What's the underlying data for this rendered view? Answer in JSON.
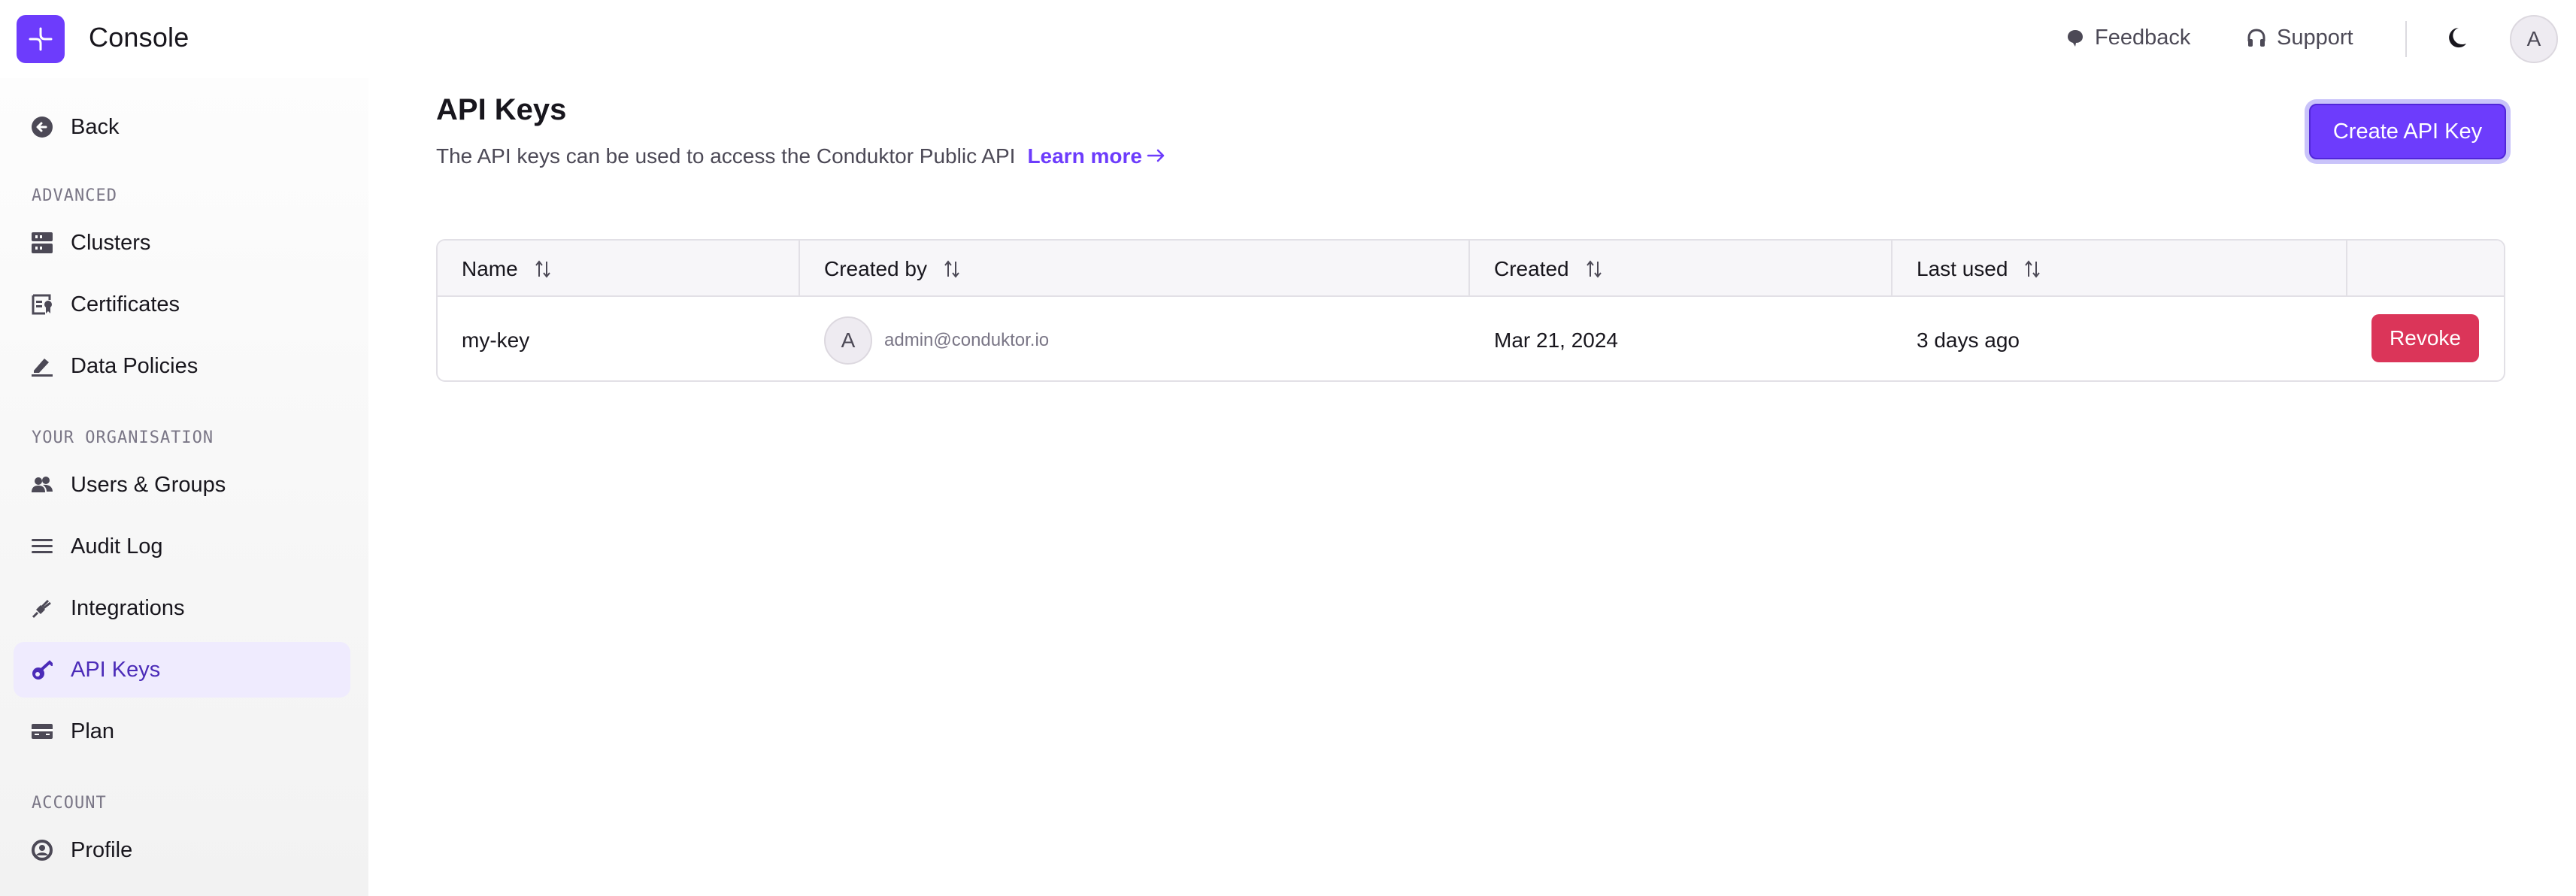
{
  "header": {
    "app_title": "Console",
    "logo_icon": "conduktor-logo-icon",
    "feedback_label": "Feedback",
    "feedback_icon": "speech-bubble-icon",
    "support_label": "Support",
    "support_icon": "headphones-icon",
    "theme_icon": "moon-icon",
    "user_initial": "A"
  },
  "sidebar": {
    "back": {
      "label": "Back",
      "icon": "arrow-left-circle-icon"
    },
    "sections": [
      {
        "title": "ADVANCED",
        "items": [
          {
            "label": "Clusters",
            "icon": "server-icon",
            "active": false
          },
          {
            "label": "Certificates",
            "icon": "certificate-icon",
            "active": false
          },
          {
            "label": "Data Policies",
            "icon": "pen-icon",
            "active": false
          }
        ]
      },
      {
        "title": "YOUR ORGANISATION",
        "items": [
          {
            "label": "Users & Groups",
            "icon": "users-icon",
            "active": false
          },
          {
            "label": "Audit Log",
            "icon": "list-icon",
            "active": false
          },
          {
            "label": "Integrations",
            "icon": "plug-icon",
            "active": false
          },
          {
            "label": "API Keys",
            "icon": "key-icon",
            "active": true
          },
          {
            "label": "Plan",
            "icon": "credit-card-icon",
            "active": false
          }
        ]
      },
      {
        "title": "ACCOUNT",
        "items": [
          {
            "label": "Profile",
            "icon": "user-circle-icon",
            "active": false
          }
        ]
      }
    ]
  },
  "main": {
    "title": "API Keys",
    "description": "The API keys can be used to access the Conduktor Public API",
    "learn_more_label": "Learn more",
    "create_button_label": "Create API Key",
    "colors": {
      "accent": "#6d3cfc",
      "danger": "#db3559",
      "active_bg": "#efebfe"
    },
    "table": {
      "columns": [
        {
          "label": "Name",
          "sortable": true
        },
        {
          "label": "Created by",
          "sortable": true
        },
        {
          "label": "Created",
          "sortable": true
        },
        {
          "label": "Last used",
          "sortable": true
        },
        {
          "label": "",
          "sortable": false
        }
      ],
      "rows": [
        {
          "name": "my-key",
          "created_by_initial": "A",
          "created_by_email": "admin@conduktor.io",
          "created": "Mar 21, 2024",
          "last_used": "3 days ago",
          "action_label": "Revoke"
        }
      ]
    }
  }
}
